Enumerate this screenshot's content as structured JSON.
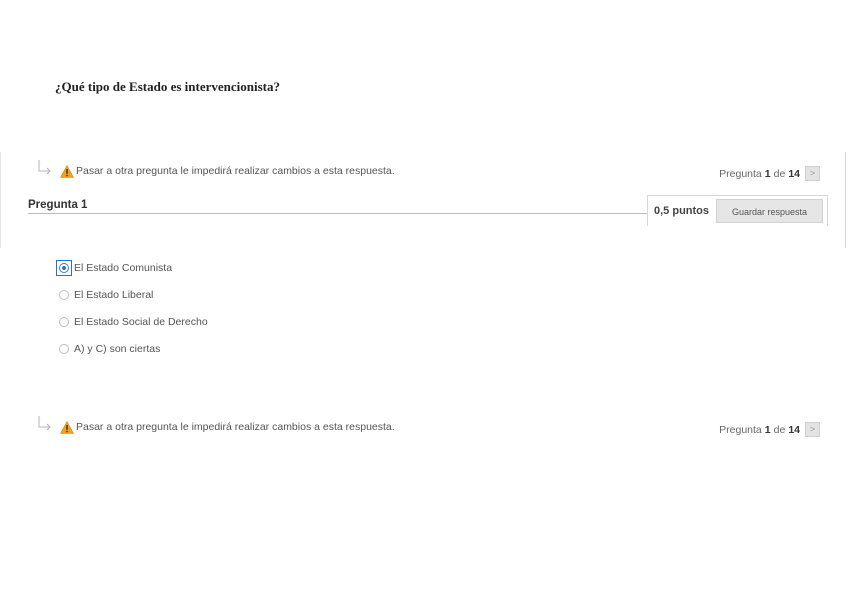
{
  "warning": {
    "text": "Pasar a otra pregunta le impedirá realizar cambios a esta respuesta."
  },
  "navigation": {
    "prefix": "Pregunta",
    "current": "1",
    "separator": "de",
    "total": "14",
    "next_symbol": ">"
  },
  "question": {
    "title": "Pregunta 1",
    "points": "0,5 puntos",
    "save_label": "Guardar respuesta",
    "text": "¿Qué tipo de Estado es intervencionista?",
    "options": [
      {
        "label": "El Estado Comunista",
        "selected": true
      },
      {
        "label": "El Estado Liberal",
        "selected": false
      },
      {
        "label": "El Estado Social de Derecho",
        "selected": false
      },
      {
        "label": "A) y C) son ciertas",
        "selected": false
      }
    ]
  },
  "colors": {
    "accent": "#2a6ed8",
    "warning": "#f0a01e"
  },
  "icons": {
    "navigate": "arrow-return-icon",
    "warning": "warning-triangle-icon",
    "next": "chevron-right-icon"
  }
}
